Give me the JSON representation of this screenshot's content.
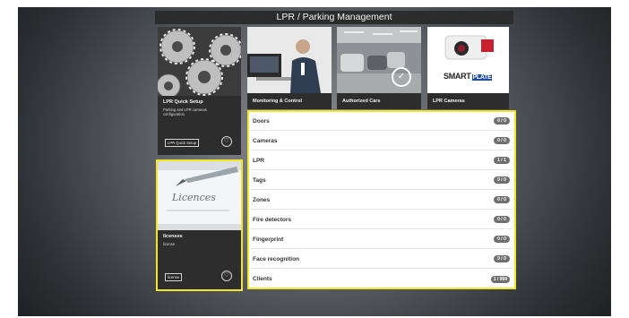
{
  "header": {
    "title": "LPR / Parking Management"
  },
  "tiles": {
    "quick_setup": {
      "title": "LPR Quick Setup",
      "description": "Parking and LPR cameras configuration",
      "button_label": "LPR Quick Setup",
      "fav_icon": "heart-icon"
    },
    "monitoring": {
      "title": "Monitoring & Control"
    },
    "authorized_cars": {
      "title": "Authorized Cars",
      "badge_icon": "check-circle-icon"
    },
    "lpr_cameras": {
      "title": "LPR Cameras",
      "brand_text": "SMART",
      "brand_suffix": "PLATE"
    },
    "licences": {
      "image_text": "Licences",
      "title": "licenses",
      "description": "license",
      "button_label": "license",
      "fav_icon": "heart-icon"
    }
  },
  "list": {
    "items": [
      {
        "label": "Doors",
        "count": "0 / 0"
      },
      {
        "label": "Cameras",
        "count": "0 / 0"
      },
      {
        "label": "LPR",
        "count": "1 / 1"
      },
      {
        "label": "Tags",
        "count": "0 / 0"
      },
      {
        "label": "Zones",
        "count": "0 / 0"
      },
      {
        "label": "Fire detectors",
        "count": "0 / 0"
      },
      {
        "label": "Fingerprint",
        "count": "0 / 0"
      },
      {
        "label": "Face recognition",
        "count": "0 / 0"
      },
      {
        "label": "Clients",
        "count": "1 / 999"
      }
    ]
  },
  "colors": {
    "highlight": "#f2e62a",
    "tile_bg": "#2d2d2d",
    "badge": "#6f6f6f"
  }
}
